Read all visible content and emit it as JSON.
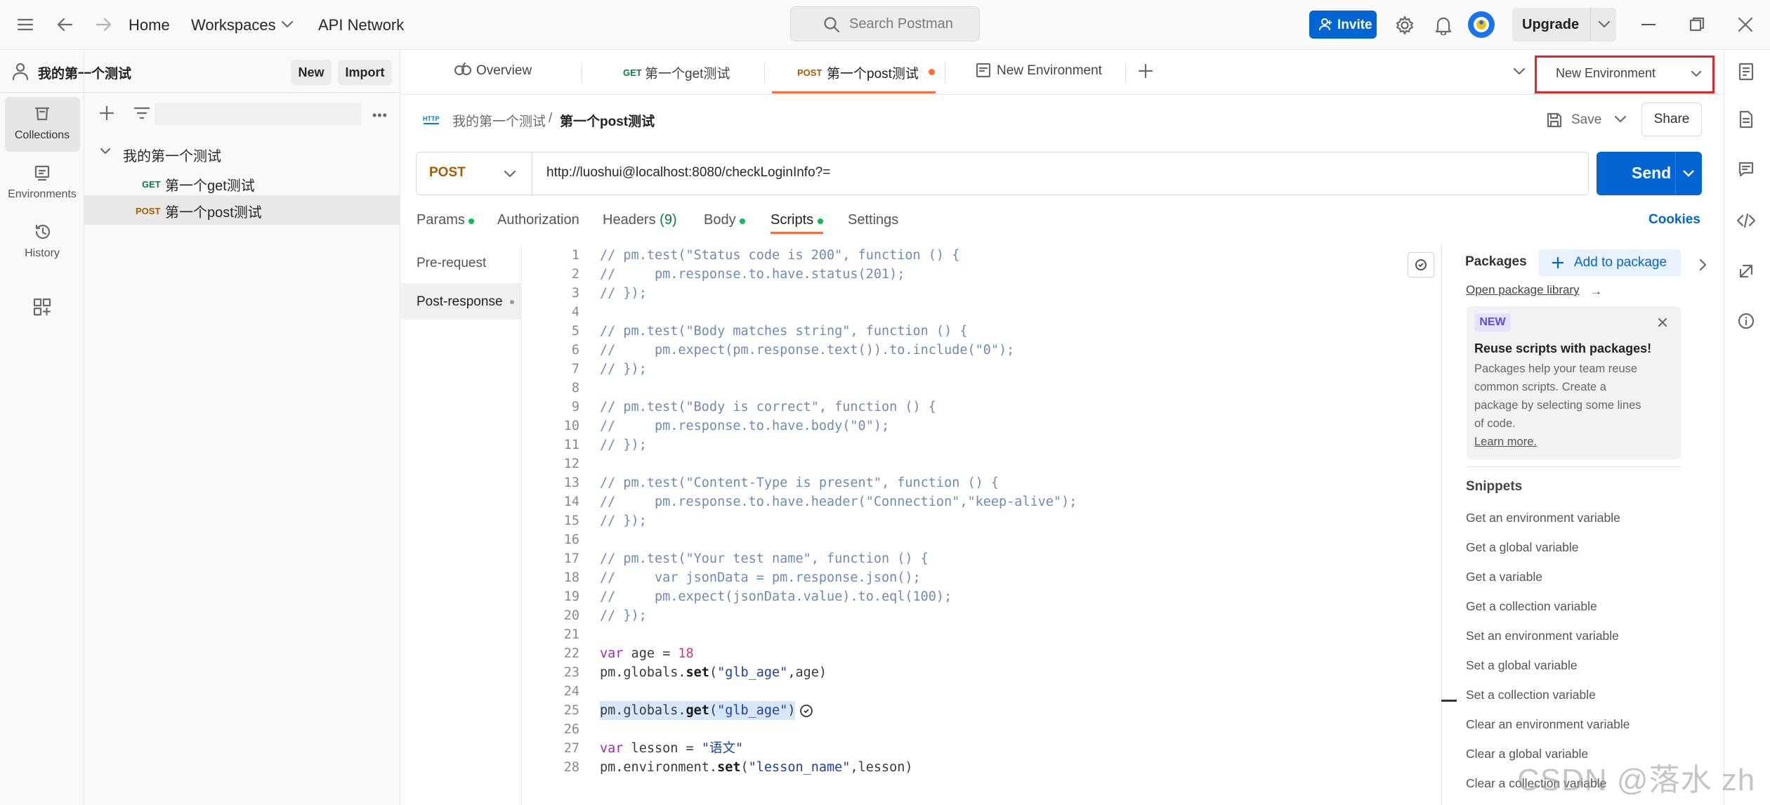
{
  "topbar": {
    "home": "Home",
    "workspaces": "Workspaces",
    "api_network": "API Network",
    "search_placeholder": "Search Postman",
    "invite": "Invite",
    "upgrade": "Upgrade"
  },
  "sidebar": {
    "workspace_name": "我的第一个测试",
    "new_label": "New",
    "import_label": "Import",
    "rail": [
      {
        "label": "Collections",
        "icon": "collections-icon"
      },
      {
        "label": "Environments",
        "icon": "environments-icon"
      },
      {
        "label": "History",
        "icon": "history-icon"
      }
    ],
    "tree": {
      "collection": "我的第一个测试",
      "items": [
        {
          "method": "GET",
          "name": "第一个get测试"
        },
        {
          "method": "POST",
          "name": "第一个post测试"
        }
      ]
    }
  },
  "tabs": [
    {
      "label": "Overview",
      "method": ""
    },
    {
      "label": "第一个get测试",
      "method": "GET"
    },
    {
      "label": "第一个post测试",
      "method": "POST"
    },
    {
      "label": "New Environment",
      "method": ""
    }
  ],
  "env_selector": "New Environment",
  "breadcrumb": {
    "tag": "HTTP",
    "parent": "我的第一个测试",
    "sep": "/",
    "current": "第一个post测试"
  },
  "actions": {
    "save": "Save",
    "share": "Share"
  },
  "request": {
    "method": "POST",
    "url": "http://luoshui@localhost:8080/checkLoginInfo?=",
    "send": "Send"
  },
  "subtabs": {
    "params": "Params",
    "authorization": "Authorization",
    "headers": "Headers",
    "headers_count": "(9)",
    "body": "Body",
    "scripts": "Scripts",
    "settings": "Settings",
    "cookies": "Cookies"
  },
  "script_nav": {
    "pre": "Pre-request",
    "post": "Post-response"
  },
  "code": [
    {
      "n": "1",
      "t": "// pm.test(\"Status code is 200\", function () {",
      "c": "cmt"
    },
    {
      "n": "2",
      "t": "//     pm.response.to.have.status(201);",
      "c": "cmt"
    },
    {
      "n": "3",
      "t": "// });",
      "c": "cmt"
    },
    {
      "n": "4",
      "t": "",
      "c": "cmt"
    },
    {
      "n": "5",
      "t": "// pm.test(\"Body matches string\", function () {",
      "c": "cmt"
    },
    {
      "n": "6",
      "t": "//     pm.expect(pm.response.text()).to.include(\"0\");",
      "c": "cmt"
    },
    {
      "n": "7",
      "t": "// });",
      "c": "cmt"
    },
    {
      "n": "8",
      "t": "",
      "c": "cmt"
    },
    {
      "n": "9",
      "t": "// pm.test(\"Body is correct\", function () {",
      "c": "cmt"
    },
    {
      "n": "10",
      "t": "//     pm.response.to.have.body(\"0\");",
      "c": "cmt"
    },
    {
      "n": "11",
      "t": "// });",
      "c": "cmt"
    },
    {
      "n": "12",
      "t": "",
      "c": "cmt"
    },
    {
      "n": "13",
      "t": "// pm.test(\"Content-Type is present\", function () {",
      "c": "cmt"
    },
    {
      "n": "14",
      "t": "//     pm.response.to.have.header(\"Connection\",\"keep-alive\");",
      "c": "cmt"
    },
    {
      "n": "15",
      "t": "// });",
      "c": "cmt"
    },
    {
      "n": "16",
      "t": "",
      "c": "cmt"
    },
    {
      "n": "17",
      "t": "// pm.test(\"Your test name\", function () {",
      "c": "cmt"
    },
    {
      "n": "18",
      "t": "//     var jsonData = pm.response.json();",
      "c": "cmt"
    },
    {
      "n": "19",
      "t": "//     pm.expect(jsonData.value).to.eql(100);",
      "c": "cmt"
    },
    {
      "n": "20",
      "t": "// });",
      "c": "cmt"
    },
    {
      "n": "21",
      "t": "",
      "c": "cmt"
    },
    {
      "n": "22",
      "parts": [
        [
          "var",
          "kw"
        ],
        [
          " age = ",
          ""
        ],
        [
          "18",
          "num"
        ]
      ]
    },
    {
      "n": "23",
      "parts": [
        [
          "pm.globals.",
          ""
        ],
        [
          "set",
          "fn"
        ],
        [
          "(",
          ""
        ],
        [
          "\"glb_age\"",
          "str"
        ],
        [
          ",age)",
          ""
        ]
      ]
    },
    {
      "n": "24",
      "parts": []
    },
    {
      "n": "25",
      "parts": [
        [
          "pm.globals.",
          ""
        ],
        [
          "get",
          "fn"
        ],
        [
          "(",
          ""
        ],
        [
          "\"glb_age\"",
          "str"
        ],
        [
          ")",
          ""
        ]
      ],
      "hl": true
    },
    {
      "n": "26",
      "parts": []
    },
    {
      "n": "27",
      "parts": [
        [
          "var",
          "kw"
        ],
        [
          " lesson = ",
          ""
        ],
        [
          "\"语文\"",
          "str"
        ]
      ]
    },
    {
      "n": "28",
      "parts": [
        [
          "pm.environment.",
          ""
        ],
        [
          "set",
          "fn"
        ],
        [
          "(",
          ""
        ],
        [
          "\"lesson_name\"",
          "str"
        ],
        [
          ",lesson)",
          ""
        ]
      ]
    }
  ],
  "packages": {
    "title": "Packages",
    "add": "Add to package",
    "open_library": "Open package library",
    "badge": "NEW",
    "card_title": "Reuse scripts with packages!",
    "card_body_1": "Packages help your team reuse",
    "card_body_2": "common scripts. Create a",
    "card_body_3": "package by selecting some lines",
    "card_body_4": "of code.",
    "learn_more": "Learn more.",
    "snippets_title": "Snippets",
    "snippets": [
      "Get an environment variable",
      "Get a global variable",
      "Get a variable",
      "Get a collection variable",
      "Set an environment variable",
      "Set a global variable",
      "Set a collection variable",
      "Clear an environment variable",
      "Clear a global variable",
      "Clear a collection variable"
    ]
  },
  "watermark": "CSDN @落水 zh",
  "colors": {
    "accent": "#0265d2",
    "highlight": "#e0242a",
    "orange": "#ff6c37"
  }
}
